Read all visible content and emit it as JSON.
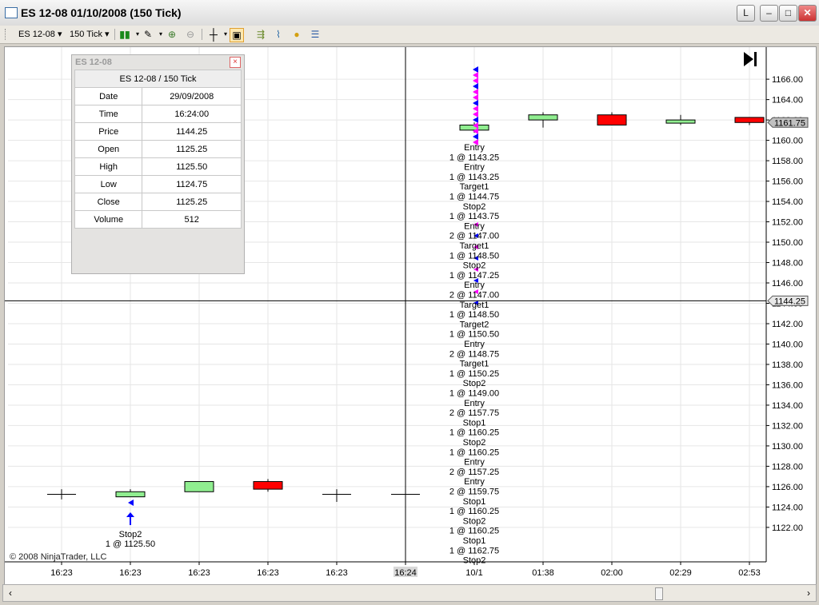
{
  "window": {
    "title": "ES 12-08  01/10/2008 (150 Tick)",
    "btn_l": "L",
    "btn_min": "–",
    "btn_max": "□",
    "btn_close": "✕"
  },
  "toolbar": {
    "instrument": "ES 12-08",
    "interval": "150 Tick"
  },
  "data_window": {
    "title": "ES 12-08",
    "header": "ES 12-08 / 150 Tick",
    "rows": [
      {
        "label": "Date",
        "value": "29/09/2008"
      },
      {
        "label": "Time",
        "value": "16:24:00"
      },
      {
        "label": "Price",
        "value": "1144.25"
      },
      {
        "label": "Open",
        "value": "1125.25"
      },
      {
        "label": "High",
        "value": "1125.50"
      },
      {
        "label": "Low",
        "value": "1124.75"
      },
      {
        "label": "Close",
        "value": "1125.25"
      },
      {
        "label": "Volume",
        "value": "512"
      }
    ]
  },
  "copyright": "© 2008 NinjaTrader, LLC",
  "chart_data": {
    "type": "candlestick",
    "y_ticks": [
      "1166.00",
      "1164.00",
      "1162.00",
      "1160.00",
      "1158.00",
      "1156.00",
      "1154.00",
      "1152.00",
      "1150.00",
      "1148.00",
      "1146.00",
      "1144.00",
      "1142.00",
      "1140.00",
      "1138.00",
      "1136.00",
      "1134.00",
      "1132.00",
      "1130.00",
      "1128.00",
      "1126.00",
      "1124.00",
      "1122.00"
    ],
    "y_tick_values": [
      1166,
      1164,
      1162,
      1160,
      1158,
      1156,
      1154,
      1152,
      1150,
      1148,
      1146,
      1144,
      1142,
      1140,
      1138,
      1136,
      1134,
      1132,
      1130,
      1128,
      1126,
      1124,
      1122
    ],
    "ylim": [
      1120.5,
      1167.5
    ],
    "x_labels": [
      "16:23",
      "16:23",
      "16:23",
      "16:23",
      "16:23",
      "16:24",
      "10/1",
      "01:38",
      "02:00",
      "02:29",
      "02:53"
    ],
    "highlighted_x_label": "16:24",
    "last_price_label": "1161.75",
    "last_price": 1161.75,
    "crosshair_price_label": "1144.25",
    "crosshair_price": 1144.25,
    "candles": [
      {
        "o": 1125.25,
        "h": 1125.75,
        "l": 1124.75,
        "c": 1125.25,
        "color": "#000000"
      },
      {
        "o": 1125.0,
        "h": 1125.75,
        "l": 1125.0,
        "c": 1125.5,
        "color": "#90ee90"
      },
      {
        "o": 1125.5,
        "h": 1126.5,
        "l": 1125.5,
        "c": 1126.5,
        "color": "#90ee90"
      },
      {
        "o": 1126.5,
        "h": 1126.75,
        "l": 1125.5,
        "c": 1125.75,
        "color": "#ff0000"
      },
      {
        "o": 1125.25,
        "h": 1125.75,
        "l": 1124.5,
        "c": 1125.25,
        "color": "#000000"
      },
      {
        "o": 1125.25,
        "h": 1125.75,
        "l": 1124.75,
        "c": 1125.25,
        "color": "#000000"
      },
      {
        "o": 1161.0,
        "h": 1161.75,
        "l": 1160.75,
        "c": 1161.5,
        "color": "#90ee90"
      },
      {
        "o": 1162.0,
        "h": 1162.75,
        "l": 1161.25,
        "c": 1162.5,
        "color": "#90ee90"
      },
      {
        "o": 1162.5,
        "h": 1162.75,
        "l": 1161.5,
        "c": 1161.5,
        "color": "#ff0000"
      },
      {
        "o": 1161.75,
        "h": 1162.5,
        "l": 1161.5,
        "c": 1162.0,
        "color": "#90ee90"
      },
      {
        "o": 1162.25,
        "h": 1162.25,
        "l": 1161.5,
        "c": 1161.75,
        "color": "#ff0000"
      }
    ],
    "execution_labels": [
      "Entry",
      "1 @ 1143.25",
      "Entry",
      "1 @ 1143.25",
      "Target1",
      "1 @ 1144.75",
      "Stop2",
      "1 @ 1143.75",
      "Entry",
      "2 @ 1147.00",
      "Target1",
      "1 @ 1148.50",
      "Stop2",
      "1 @ 1147.25",
      "Entry",
      "2 @ 1147.00",
      "Target1",
      "1 @ 1148.50",
      "Target2",
      "1 @ 1150.50",
      "Entry",
      "2 @ 1148.75",
      "Target1",
      "1 @ 1150.25",
      "Stop2",
      "1 @ 1149.00",
      "Entry",
      "2 @ 1157.75",
      "Stop1",
      "1 @ 1160.25",
      "Stop2",
      "1 @ 1160.25",
      "Entry",
      "2 @ 1157.25",
      "Entry",
      "2 @ 1159.75",
      "Stop1",
      "1 @ 1160.25",
      "Stop2",
      "1 @ 1160.25",
      "Stop1",
      "1 @ 1162.75",
      "Stop2"
    ],
    "bar1_execution_labels": [
      "Stop2",
      "1 @ 1125.50"
    ],
    "grid": true
  }
}
